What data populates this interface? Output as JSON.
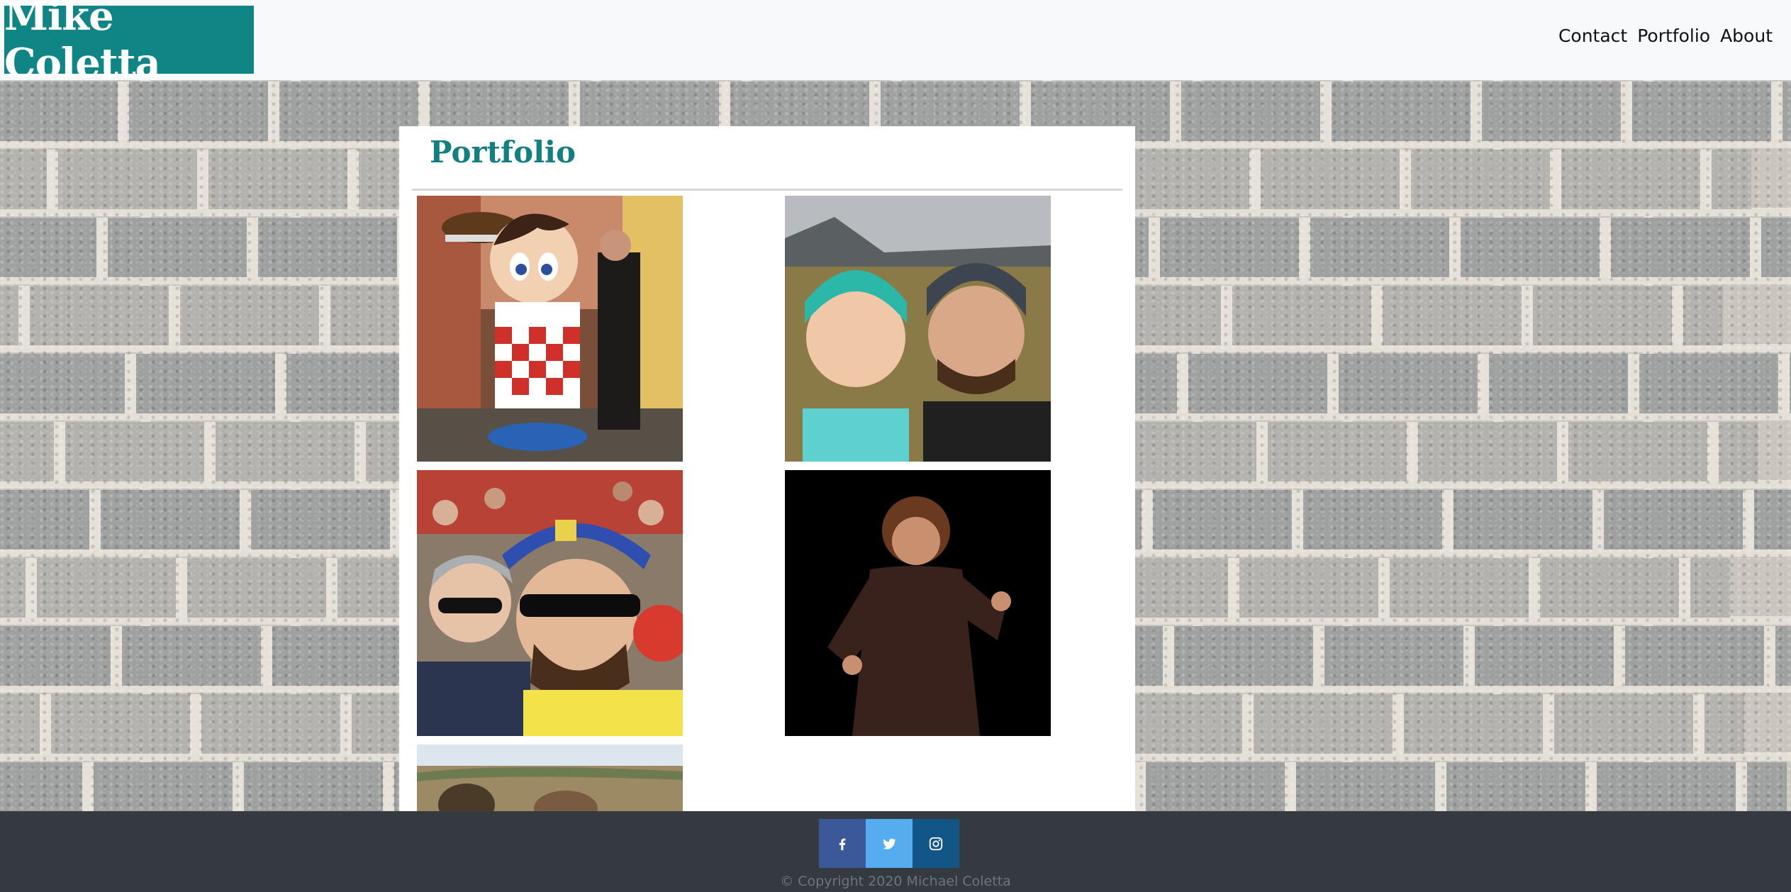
{
  "navbar": {
    "brand": "Mike Coletta",
    "brand_color": "#0f8585",
    "links": [
      "Contact",
      "Portfolio",
      "About"
    ]
  },
  "main": {
    "title": "Portfolio",
    "title_color": "#137f80",
    "photos": [
      {
        "name": "photo-big-boy-statue",
        "description_icon": "photo"
      },
      {
        "name": "photo-couple-selfie",
        "description_icon": "photo"
      },
      {
        "name": "photo-stadium-selfie",
        "description_icon": "photo"
      },
      {
        "name": "photo-standup-performance",
        "description_icon": "photo"
      },
      {
        "name": "photo-landscape-partial",
        "description_icon": "photo"
      }
    ]
  },
  "footer": {
    "social": [
      {
        "icon": "facebook-icon",
        "color": "#3b5998"
      },
      {
        "icon": "twitter-icon",
        "color": "#55acee"
      },
      {
        "icon": "instagram-icon",
        "color": "#125688"
      }
    ],
    "copyright": "© Copyright 2020 Michael Coletta",
    "background": "#343a40"
  }
}
